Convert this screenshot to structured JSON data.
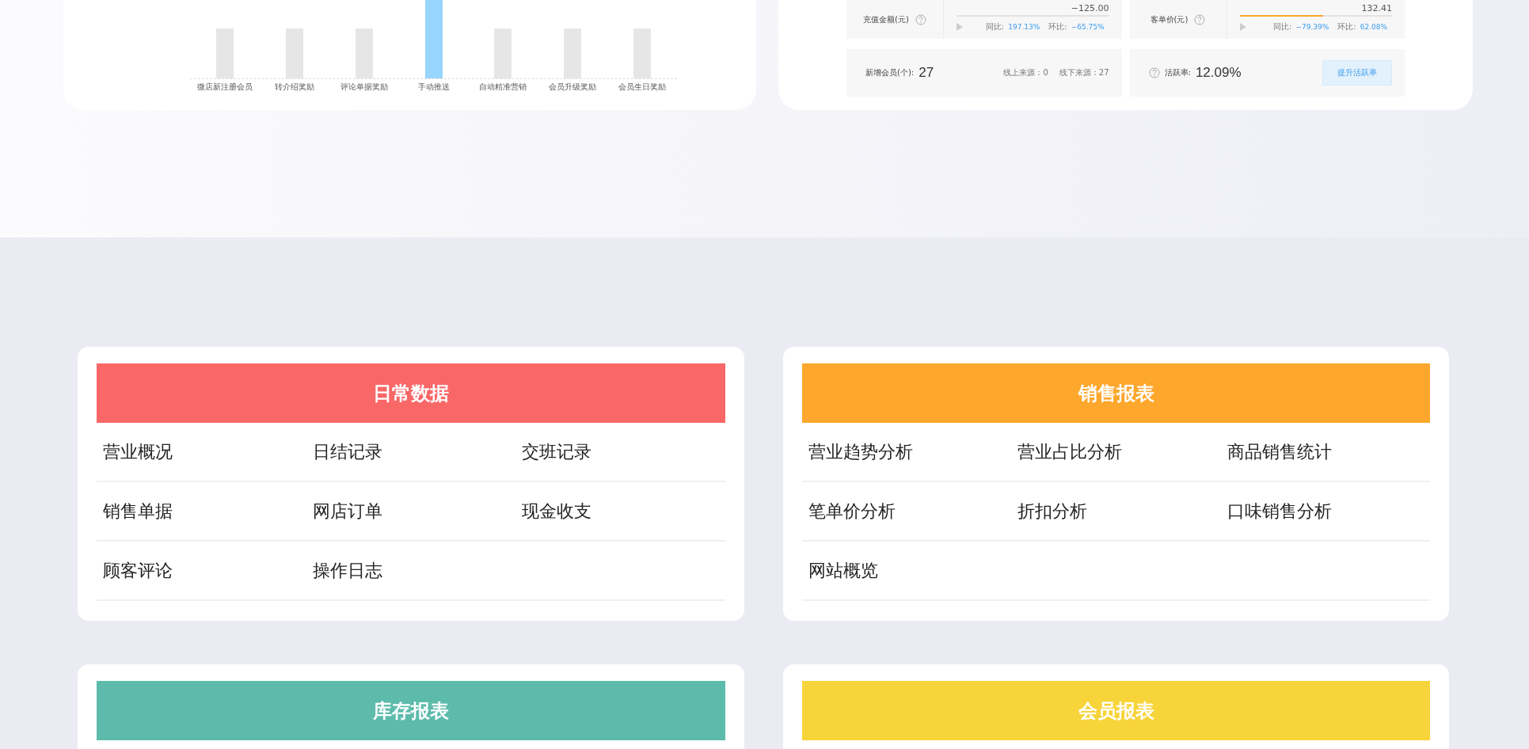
{
  "overview": {
    "chart": {
      "bars": [
        {
          "label": "微店新注册会员",
          "selected": false
        },
        {
          "label": "转介绍奖励",
          "selected": false
        },
        {
          "label": "评论单据奖励",
          "selected": false
        },
        {
          "label": "手动推送",
          "selected": true
        },
        {
          "label": "自动精准营销",
          "selected": false
        },
        {
          "label": "会员升级奖励",
          "selected": false
        },
        {
          "label": "会员生日奖励",
          "selected": false
        }
      ]
    },
    "stats": [
      {
        "label": "充值金额(元)",
        "value": "−125.00",
        "level": 0,
        "yoy_label": "同比:",
        "yoy": "197.13%",
        "mom_label": "环比:",
        "mom": "−65.75%"
      },
      {
        "label": "客单价(元)",
        "value": "132.41",
        "level": 0.55,
        "yoy_label": "同比:",
        "yoy": "−79.39%",
        "mom_label": "环比:",
        "mom": "62.08%"
      }
    ],
    "new_members": {
      "label": "新增会员(个):",
      "value": "27",
      "online": "线上来源：0",
      "offline": "线下来源：27"
    },
    "activity": {
      "label": "活跃率:",
      "value": "12.09%",
      "button": "提升活跃率"
    }
  },
  "report_panels": [
    {
      "title": "日常数据",
      "color": "#f96767",
      "items": [
        "营业概况",
        "日结记录",
        "交班记录",
        "销售单据",
        "网店订单",
        "现金收支",
        "顾客评论",
        "操作日志"
      ]
    },
    {
      "title": "销售报表",
      "color": "#fda72c",
      "items": [
        "营业趋势分析",
        "营业占比分析",
        "商品销售统计",
        "笔单价分析",
        "折扣分析",
        "口味销售分析",
        "网站概览"
      ]
    },
    {
      "title": "库存报表",
      "color": "#5dbbab"
    },
    {
      "title": "会员报表",
      "color": "#f7d43a"
    }
  ]
}
